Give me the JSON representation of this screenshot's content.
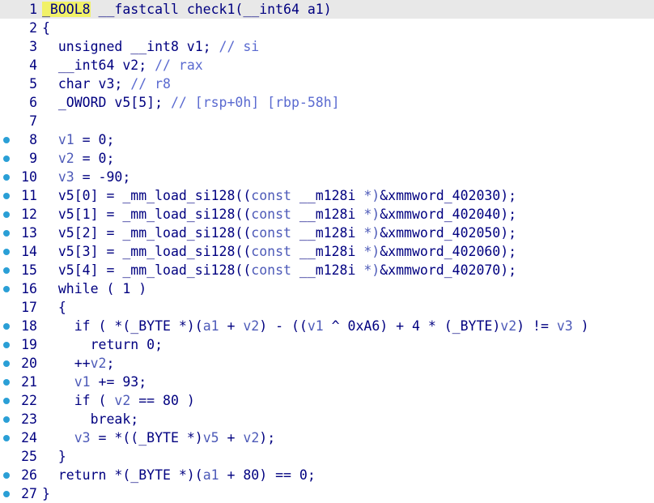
{
  "editor": {
    "lines": [
      {
        "num": "1",
        "bp": false,
        "tokens": [
          {
            "t": "_BOOL8",
            "c": "type-hl"
          },
          {
            "t": " __fastcall check1(__int64 a1)",
            "c": "plain"
          }
        ]
      },
      {
        "num": "2",
        "bp": false,
        "tokens": [
          {
            "t": "{",
            "c": "plain"
          }
        ]
      },
      {
        "num": "3",
        "bp": false,
        "tokens": [
          {
            "t": "  unsigned __int8 v1; ",
            "c": "plain"
          },
          {
            "t": "// si",
            "c": "comment"
          }
        ]
      },
      {
        "num": "4",
        "bp": false,
        "tokens": [
          {
            "t": "  __int64 v2; ",
            "c": "plain"
          },
          {
            "t": "// rax",
            "c": "comment"
          }
        ]
      },
      {
        "num": "5",
        "bp": false,
        "tokens": [
          {
            "t": "  char v3; ",
            "c": "plain"
          },
          {
            "t": "// r8",
            "c": "comment"
          }
        ]
      },
      {
        "num": "6",
        "bp": false,
        "tokens": [
          {
            "t": "  _OWORD v5[5]; ",
            "c": "plain"
          },
          {
            "t": "// [rsp+0h] [rbp-58h]",
            "c": "comment"
          }
        ]
      },
      {
        "num": "7",
        "bp": false,
        "tokens": [
          {
            "t": "",
            "c": "plain"
          }
        ]
      },
      {
        "num": "8",
        "bp": true,
        "tokens": [
          {
            "t": "  v1",
            "c": "var"
          },
          {
            "t": " = 0;",
            "c": "plain"
          }
        ]
      },
      {
        "num": "9",
        "bp": true,
        "tokens": [
          {
            "t": "  v2",
            "c": "var"
          },
          {
            "t": " = 0;",
            "c": "plain"
          }
        ]
      },
      {
        "num": "10",
        "bp": true,
        "tokens": [
          {
            "t": "  v3",
            "c": "var"
          },
          {
            "t": " = -90;",
            "c": "plain"
          }
        ]
      },
      {
        "num": "11",
        "bp": true,
        "tokens": [
          {
            "t": "  v5[0] = _mm_load_si128((",
            "c": "plain"
          },
          {
            "t": "const",
            "c": "var"
          },
          {
            "t": " __m128i ",
            "c": "plain"
          },
          {
            "t": "*)",
            "c": "var"
          },
          {
            "t": "&xmmword_402030);",
            "c": "plain"
          }
        ]
      },
      {
        "num": "12",
        "bp": true,
        "tokens": [
          {
            "t": "  v5[1] = _mm_load_si128((",
            "c": "plain"
          },
          {
            "t": "const",
            "c": "var"
          },
          {
            "t": " __m128i ",
            "c": "plain"
          },
          {
            "t": "*)",
            "c": "var"
          },
          {
            "t": "&xmmword_402040);",
            "c": "plain"
          }
        ]
      },
      {
        "num": "13",
        "bp": true,
        "tokens": [
          {
            "t": "  v5[2] = _mm_load_si128((",
            "c": "plain"
          },
          {
            "t": "const",
            "c": "var"
          },
          {
            "t": " __m128i ",
            "c": "plain"
          },
          {
            "t": "*)",
            "c": "var"
          },
          {
            "t": "&xmmword_402050);",
            "c": "plain"
          }
        ]
      },
      {
        "num": "14",
        "bp": true,
        "tokens": [
          {
            "t": "  v5[3] = _mm_load_si128((",
            "c": "plain"
          },
          {
            "t": "const",
            "c": "var"
          },
          {
            "t": " __m128i ",
            "c": "plain"
          },
          {
            "t": "*)",
            "c": "var"
          },
          {
            "t": "&xmmword_402060);",
            "c": "plain"
          }
        ]
      },
      {
        "num": "15",
        "bp": true,
        "tokens": [
          {
            "t": "  v5[4] = _mm_load_si128((",
            "c": "plain"
          },
          {
            "t": "const",
            "c": "var"
          },
          {
            "t": " __m128i ",
            "c": "plain"
          },
          {
            "t": "*)",
            "c": "var"
          },
          {
            "t": "&xmmword_402070);",
            "c": "plain"
          }
        ]
      },
      {
        "num": "16",
        "bp": true,
        "tokens": [
          {
            "t": "  while ( 1 )",
            "c": "plain"
          }
        ]
      },
      {
        "num": "17",
        "bp": false,
        "tokens": [
          {
            "t": "  {",
            "c": "plain"
          }
        ]
      },
      {
        "num": "18",
        "bp": true,
        "tokens": [
          {
            "t": "    if ( *(_BYTE *)(",
            "c": "plain"
          },
          {
            "t": "a1",
            "c": "var"
          },
          {
            "t": " + ",
            "c": "plain"
          },
          {
            "t": "v2",
            "c": "var"
          },
          {
            "t": ") - ((",
            "c": "plain"
          },
          {
            "t": "v1",
            "c": "var"
          },
          {
            "t": " ^ 0xA6) + 4 * (_BYTE)",
            "c": "plain"
          },
          {
            "t": "v2",
            "c": "var"
          },
          {
            "t": ") != ",
            "c": "plain"
          },
          {
            "t": "v3",
            "c": "var"
          },
          {
            "t": " )",
            "c": "plain"
          }
        ]
      },
      {
        "num": "19",
        "bp": true,
        "tokens": [
          {
            "t": "      return 0;",
            "c": "plain"
          }
        ]
      },
      {
        "num": "20",
        "bp": true,
        "tokens": [
          {
            "t": "    ++",
            "c": "plain"
          },
          {
            "t": "v2",
            "c": "var"
          },
          {
            "t": ";",
            "c": "plain"
          }
        ]
      },
      {
        "num": "21",
        "bp": true,
        "tokens": [
          {
            "t": "    ",
            "c": "plain"
          },
          {
            "t": "v1",
            "c": "var"
          },
          {
            "t": " += 93;",
            "c": "plain"
          }
        ]
      },
      {
        "num": "22",
        "bp": true,
        "tokens": [
          {
            "t": "    if ( ",
            "c": "plain"
          },
          {
            "t": "v2",
            "c": "var"
          },
          {
            "t": " == 80 )",
            "c": "plain"
          }
        ]
      },
      {
        "num": "23",
        "bp": true,
        "tokens": [
          {
            "t": "      break;",
            "c": "plain"
          }
        ]
      },
      {
        "num": "24",
        "bp": true,
        "tokens": [
          {
            "t": "    ",
            "c": "plain"
          },
          {
            "t": "v3",
            "c": "var"
          },
          {
            "t": " = *((_BYTE *)",
            "c": "plain"
          },
          {
            "t": "v5",
            "c": "var"
          },
          {
            "t": " + ",
            "c": "plain"
          },
          {
            "t": "v2",
            "c": "var"
          },
          {
            "t": ");",
            "c": "plain"
          }
        ]
      },
      {
        "num": "25",
        "bp": false,
        "tokens": [
          {
            "t": "  }",
            "c": "plain"
          }
        ]
      },
      {
        "num": "26",
        "bp": true,
        "tokens": [
          {
            "t": "  return *(_BYTE *)(",
            "c": "plain"
          },
          {
            "t": "a1",
            "c": "var"
          },
          {
            "t": " + 80) == 0;",
            "c": "plain"
          }
        ]
      },
      {
        "num": "27",
        "bp": true,
        "tokens": [
          {
            "t": "}",
            "c": "plain"
          }
        ]
      }
    ]
  }
}
